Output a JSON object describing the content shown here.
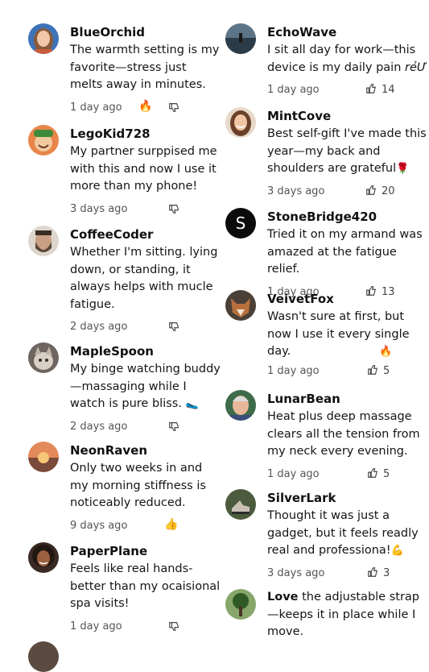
{
  "left_comments": [
    {
      "name": "BlueOrchid",
      "text": "The warmth setting is my favorite—stress just melts away in minutes.",
      "time": "1 day ago",
      "reaction": "🔥",
      "avatar_icon": "woman-avatar"
    },
    {
      "name": "LegoKid728",
      "text": "My partner surppised me with this and now I use it more than my phone!",
      "time": "3 days ago",
      "avatar_icon": "smiling-man-green-hat-avatar"
    },
    {
      "name": "CoffeeCoder",
      "text": "Whether I'm sitting. lying down, or standing, it always helps with mucle fatigue.",
      "time": "2 days ago",
      "avatar_icon": "bearded-man-avatar"
    },
    {
      "name": "MapleSpoon",
      "text": "My binge watching buddy—massaging while I watch is pure bliss.",
      "text_emoji": "🥿",
      "time": "2 days ago",
      "avatar_icon": "cat-avatar"
    },
    {
      "name": "NeonRaven",
      "text": "Only two weeks in and my morning stiffness is noticeably reduced.",
      "time": "9 days ago",
      "reaction": "👍",
      "avatar_icon": "sunset-avatar"
    },
    {
      "name": "PaperPlane",
      "text": "Feels like real hands-better than my ocaisional spa visits!",
      "time": "1 day ago",
      "avatar_icon": "curly-hair-woman-avatar"
    }
  ],
  "right_comments": [
    {
      "name": "EchoWave",
      "text": "I sit all day for work—this device is my daily pain",
      "text_tail": "rẻƯ",
      "time": "1 day ago",
      "likes": "14",
      "avatar_icon": "lake-person-avatar"
    },
    {
      "name": "MintCove",
      "text": "Best self-gift I've made this year—my back and shoulders are grateful",
      "text_emoji": "🌹",
      "time": "3 days ago",
      "likes": "20",
      "avatar_icon": "smiling-woman-avatar"
    },
    {
      "name": "StoneBridge420",
      "text": "Tried it on my armand was amazed at the fatigue relief.",
      "time": "1 day ago",
      "likes": "13",
      "avatar_icon": "letter-avatar",
      "avatar_letter": "S"
    },
    {
      "name": "VeivetFox",
      "text": "Wasn't sure at first, but now I use it every single day.",
      "text_emoji": "🔥",
      "time": "1 day ago",
      "likes": "5",
      "avatar_icon": "fox-avatar"
    },
    {
      "name": "LunarBean",
      "text": "Heat plus deep massage clears all the tension from my neck every evening.",
      "time": "1 day ago",
      "likes": "5",
      "avatar_icon": "older-man-avatar"
    },
    {
      "name": "SilverLark",
      "text": "Thought it was just a gadget, but it feels readly real and professiona!",
      "text_emoji": "💪",
      "time": "3 days ago",
      "likes": "3",
      "avatar_icon": "shoes-avatar"
    },
    {
      "name": "Love",
      "text": " the adjustable strap—keeps it in place while I move.",
      "avatar_icon": "tree-avatar"
    }
  ],
  "colors": {
    "text": "#111111",
    "meta": "#555555",
    "letter_avatar_bg": "#0b0b0b"
  }
}
